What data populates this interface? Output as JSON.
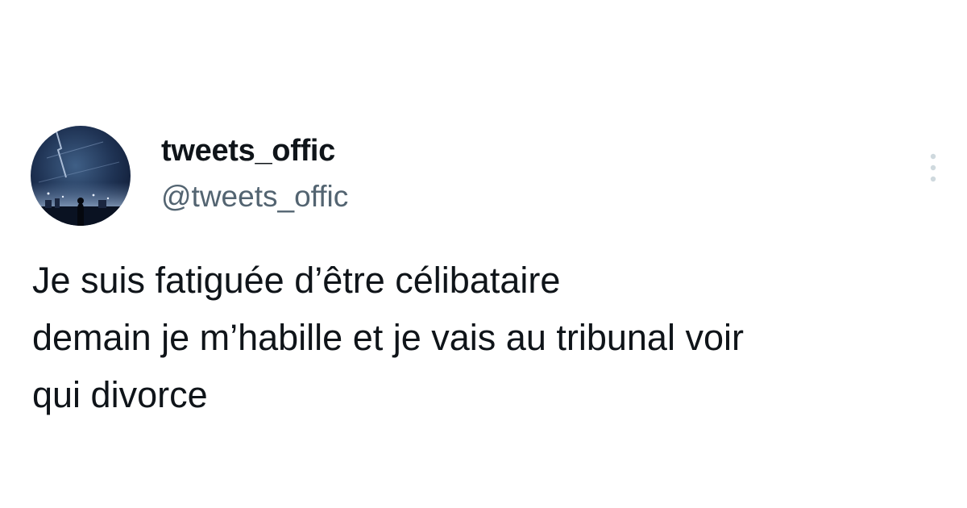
{
  "tweet": {
    "author": {
      "display_name": "tweets_offic",
      "handle": "@tweets_offic",
      "avatar_icon": "night-sky-avatar"
    },
    "more_icon": "more-vertical-icon",
    "text_lines": [
      "Je suis fatiguée d’être célibataire",
      "demain je m’habille et je vais au tribunal voir",
      "qui divorce"
    ]
  },
  "colors": {
    "background": "#ffffff",
    "text_primary": "#0f1419",
    "text_secondary": "#536471",
    "more_icon": "#cfd9de"
  }
}
